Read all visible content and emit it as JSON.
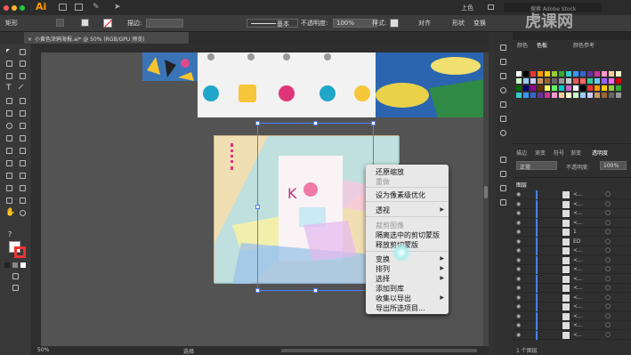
{
  "app": {
    "logo": "Ai",
    "workspace_label": "矩形"
  },
  "topbar": {
    "title": "上色",
    "search_placeholder": "搜索 Adobe Stock"
  },
  "control_bar": {
    "stroke_label": "描边:",
    "basic_label": "基本",
    "opacity_label": "不透明度:",
    "opacity_value": "100%",
    "style_label": "样式:",
    "align_label": "对齐",
    "shape_label": "形状",
    "transform_label": "变换"
  },
  "document_tab": {
    "label": "小黄色涂鸦海报.ai* @ 50% (RGB/GPU 预览)"
  },
  "status_bar": {
    "zoom": "50%",
    "tool": "选择"
  },
  "panel": {
    "top_tabs": [
      "颜色",
      "色板",
      "颜色参考"
    ],
    "mid_tabs": [
      "描边",
      "渐变",
      "符号",
      "渐变",
      "透明度"
    ],
    "blend_mode": "正常",
    "opacity_label": "不透明度:",
    "opacity_value": "100%",
    "layers_tab": "图层",
    "layers_count": "1 个图层",
    "layer_rows": [
      "<...",
      "<...",
      "<...",
      "<...",
      "1",
      "ED",
      "<...",
      "<...",
      "<...",
      "<...",
      "<...",
      "<...",
      "<...",
      "<...",
      "<...",
      "<..."
    ]
  },
  "context_menu": {
    "items": [
      {
        "label": "还原缩放",
        "enabled": true
      },
      {
        "label": "重做",
        "enabled": false
      },
      {
        "label": "设为像素级优化",
        "enabled": true
      },
      {
        "label": "透视",
        "enabled": true,
        "submenu": true
      },
      {
        "label": "裁剪图像",
        "enabled": false
      },
      {
        "label": "隔离选中的剪切蒙版",
        "enabled": true
      },
      {
        "label": "释放剪切蒙版",
        "enabled": true
      },
      {
        "label": "变换",
        "enabled": true,
        "submenu": true
      },
      {
        "label": "排列",
        "enabled": true,
        "submenu": true
      },
      {
        "label": "选择",
        "enabled": true,
        "submenu": true
      },
      {
        "label": "添加到库",
        "enabled": true
      },
      {
        "label": "收集以导出",
        "enabled": true,
        "submenu": true
      },
      {
        "label": "导出所选项目...",
        "enabled": true
      }
    ]
  },
  "watermark": "虎课网",
  "colors": {
    "accent": "#ff9a00",
    "poster_bg": "#f1dfb4",
    "selection": "#4a7fff"
  }
}
